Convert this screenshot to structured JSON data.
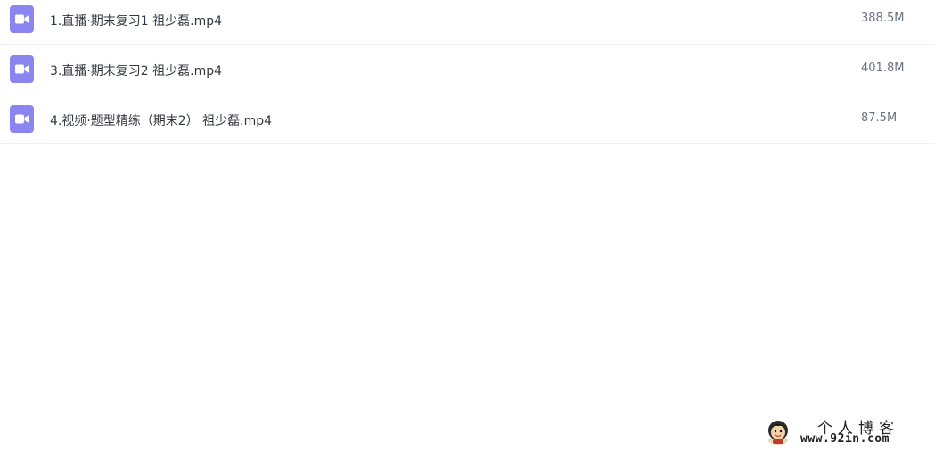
{
  "files": [
    {
      "name": "1.直播·期末复习1 祖少磊.mp4",
      "size": "388.5M",
      "icon": "video-file-icon"
    },
    {
      "name": "3.直播·期末复习2 祖少磊.mp4",
      "size": "401.8M",
      "icon": "video-file-icon"
    },
    {
      "name": "4.视频·题型精练（期末2） 祖少磊.mp4",
      "size": "87.5M",
      "icon": "video-file-icon"
    }
  ],
  "watermark": {
    "title": "个人博客",
    "url": "www.92in.com"
  },
  "colors": {
    "icon_bg": "#8b85ef",
    "divider": "#eef0f4",
    "text": "#333840",
    "size_text": "#6b7280"
  }
}
